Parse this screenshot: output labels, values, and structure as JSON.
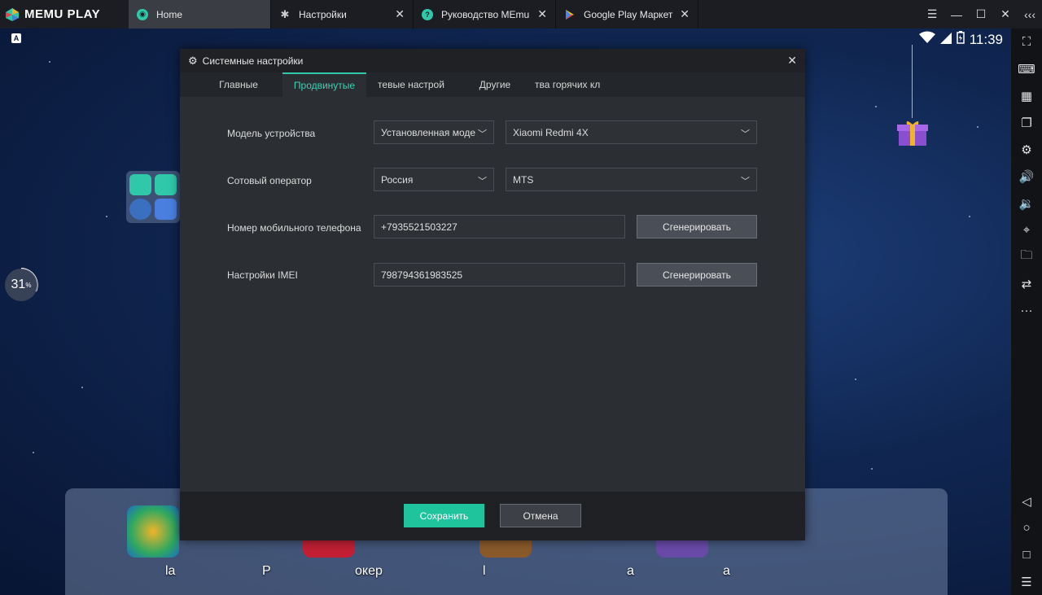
{
  "app": {
    "name": "MEMU PLAY"
  },
  "tabs": [
    {
      "label": "Home",
      "icon": "memu-icon",
      "active": true
    },
    {
      "label": "Настройки",
      "icon": "gear-icon"
    },
    {
      "label": "Руководство MEmu",
      "icon": "help-icon"
    },
    {
      "label": "Google Play Маркет",
      "icon": "play-store-icon"
    }
  ],
  "status": {
    "time": "11:39"
  },
  "percent": {
    "value": "31",
    "unit": "%"
  },
  "dock": {
    "labels": [
      "la",
      "P",
      "окер",
      "l",
      "a",
      "a"
    ]
  },
  "dialog": {
    "title": "Системные настройки",
    "tabs": [
      "Главные",
      "Продвинутые",
      "тевые настрой",
      "Другие",
      "тва горячих кл"
    ],
    "active_tab": "Продвинутые",
    "rows": {
      "model_label": "Модель устройства",
      "model_type": "Установленная моде",
      "model_value": "Xiaomi Redmi 4X",
      "operator_label": "Сотовый оператор",
      "country": "Россия",
      "operator": "MTS",
      "phone_label": "Номер мобильного телефона",
      "phone_value": "+7935521503227",
      "imei_label": "Настройки IMEI",
      "imei_value": "798794361983525",
      "generate_label": "Сгенерировать"
    },
    "save_label": "Сохранить",
    "cancel_label": "Отмена"
  },
  "colors": {
    "accent": "#1fc39c",
    "tab_active": "#3fd0b4",
    "dialog_bg": "#2b2e33",
    "titlebar": "#1b1d22"
  }
}
